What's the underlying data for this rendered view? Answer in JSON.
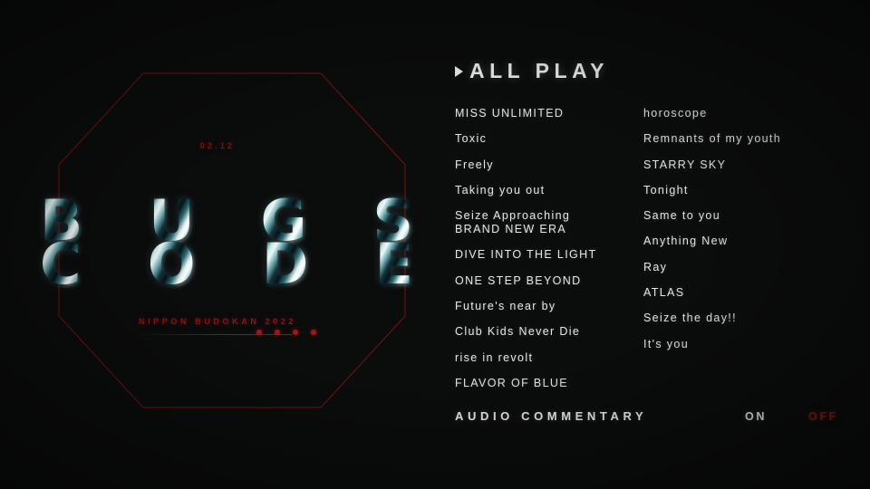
{
  "theme": {
    "background": "#0b0c0c",
    "text": "#e6e6e6",
    "accent_red": "#8d1515",
    "accent_red_bright": "#a81414",
    "chrome_teal": "#bfe6e8"
  },
  "artwork": {
    "date_stamp": "02.12",
    "wordmark_top": [
      "B",
      "U",
      "G",
      "S"
    ],
    "wordmark_bottom": [
      "C",
      "O",
      "D",
      "E"
    ],
    "venue": "NIPPON BUDOKAN 2022",
    "dot_count": 4
  },
  "menu": {
    "all_play": {
      "label": "ALL PLAY",
      "caret_icon": "play-triangle-icon"
    },
    "tracks_left": [
      {
        "title": "MISS UNLIMITED"
      },
      {
        "title": "Toxic"
      },
      {
        "title": "Freely"
      },
      {
        "title": "Taking you out"
      },
      {
        "title": "Seize Approaching",
        "title_line2": "BRAND NEW ERA"
      },
      {
        "title": "DIVE INTO THE LIGHT"
      },
      {
        "title": "ONE STEP BEYOND"
      },
      {
        "title": "Future's near by"
      },
      {
        "title": "Club Kids Never Die"
      },
      {
        "title": "rise in revolt"
      },
      {
        "title": "FLAVOR OF BLUE"
      }
    ],
    "tracks_right": [
      {
        "title": "horoscope"
      },
      {
        "title": "Remnants of my youth"
      },
      {
        "title": "STARRY SKY"
      },
      {
        "title": "Tonight"
      },
      {
        "title": "Same to you"
      },
      {
        "title": "Anything New"
      },
      {
        "title": "Ray"
      },
      {
        "title": "ATLAS"
      },
      {
        "title": "Seize the day!!"
      },
      {
        "title": "It's you"
      }
    ],
    "audio_commentary": {
      "label": "AUDIO COMMENTARY",
      "option_on": "ON",
      "option_off": "OFF",
      "selected": "OFF"
    }
  }
}
